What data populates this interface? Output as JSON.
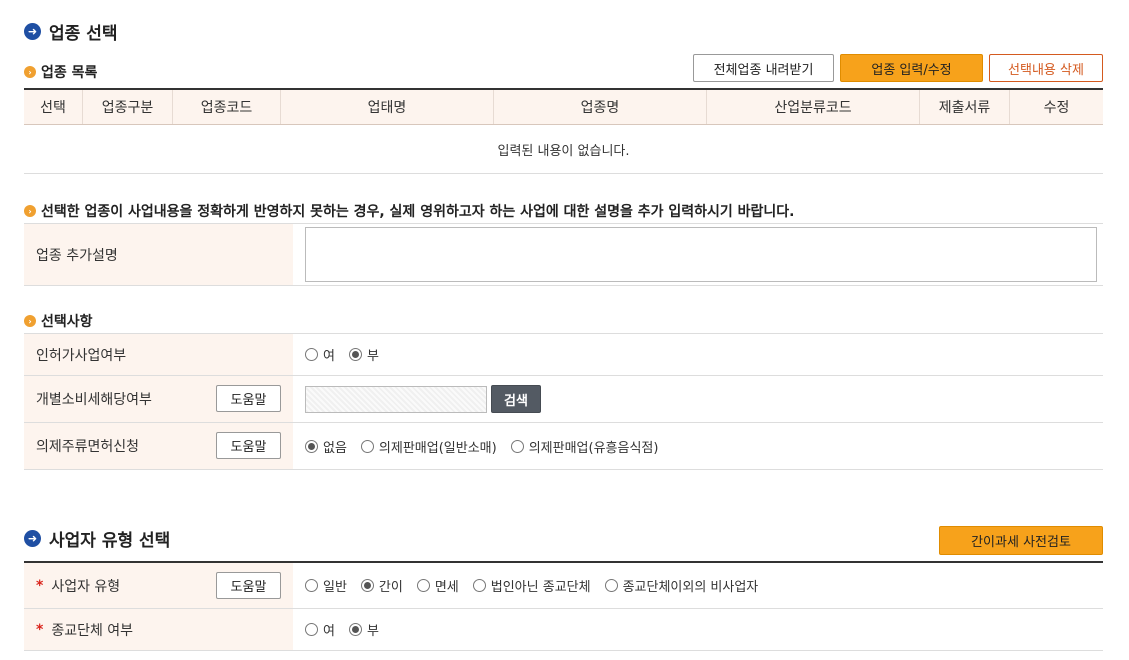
{
  "section1": {
    "title": "업종 선택",
    "list_title": "업종 목록",
    "buttons": {
      "download": "전체업종 내려받기",
      "edit": "업종 입력/수정",
      "delete": "선택내용 삭제"
    },
    "columns": [
      "선택",
      "업종구분",
      "업종코드",
      "업태명",
      "업종명",
      "산업분류코드",
      "제출서류",
      "수정"
    ],
    "empty_message": "입력된 내용이 없습니다.",
    "notice": "선택한 업종이 사업내용을 정확하게 반영하지 못하는 경우, 실제 영위하고자 하는 사업에 대한 설명을 추가 입력하시기 바랍니다.",
    "extra_desc_label": "업종 추가설명",
    "extra_desc_value": ""
  },
  "options": {
    "title": "선택사항",
    "license": {
      "label": "인허가사업여부",
      "options": [
        "여",
        "부"
      ],
      "selected": "부"
    },
    "excise": {
      "label": "개별소비세해당여부",
      "help": "도움말",
      "search": "검색",
      "value": ""
    },
    "liquor": {
      "label": "의제주류면허신청",
      "help": "도움말",
      "options": [
        "없음",
        "의제판매업(일반소매)",
        "의제판매업(유흥음식점)"
      ],
      "selected": "없음"
    }
  },
  "section2": {
    "title": "사업자 유형 선택",
    "review_button": "간이과세 사전검토",
    "biz_type": {
      "label": "사업자 유형",
      "help": "도움말",
      "options": [
        "일반",
        "간이",
        "면세",
        "법인아닌 종교단체",
        "종교단체이외의 비사업자"
      ],
      "selected": "간이"
    },
    "religious": {
      "label": "종교단체 여부",
      "options": [
        "여",
        "부"
      ],
      "selected": "부"
    },
    "required_mark": "*"
  },
  "colors": {
    "accent_orange": "#f7a21b",
    "header_bg": "#fdf4ee",
    "bullet_blue": "#1f4fa3",
    "required_red": "#d9231b"
  }
}
